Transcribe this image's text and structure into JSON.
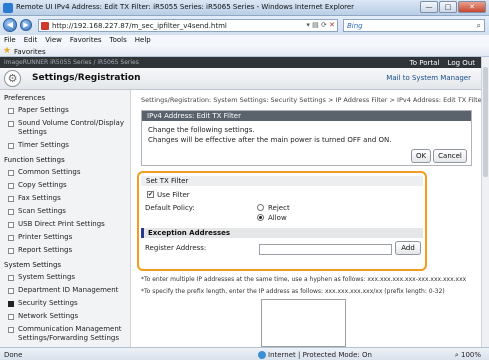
{
  "window": {
    "title": "Remote UI IPv4 Address: Edit TX Filter: iR5055 Series: iR5065 Series - Windows Internet Explorer",
    "min": "—",
    "max": "□",
    "close": "✕"
  },
  "browser": {
    "url": "http://192.168.227.87/m_sec_ipfilter_v4send.html",
    "search_placeholder": "Bing",
    "menu": [
      "File",
      "Edit",
      "View",
      "Favorites",
      "Tools",
      "Help"
    ],
    "favorites_label": "Favorites"
  },
  "device_bar": {
    "device_name": "imageRUNNER  iR5055 Series / iR5065 Series",
    "to_portal": "To Portal",
    "log_out": "Log Out"
  },
  "header": {
    "title": "Settings/Registration",
    "mail": "Mail to System Manager"
  },
  "sidebar": {
    "preferences": "Preferences",
    "pref_items": [
      "Paper Settings",
      "Sound Volume Control/Display Settings",
      "Timer Settings"
    ],
    "function_settings": "Function Settings",
    "func_items": [
      "Common Settings",
      "Copy Settings",
      "Fax Settings",
      "Scan Settings",
      "USB Direct Print Settings",
      "Printer Settings",
      "Report Settings"
    ],
    "system_settings": "System Settings",
    "sys_items": [
      "System Settings",
      "Department ID Management",
      "Security Settings",
      "Network Settings",
      "Communication Management Settings/Forwarding Settings"
    ]
  },
  "main": {
    "breadcrumb": "Settings/Registration: System Settings: Security Settings > IP Address Filter > IPv4 Address: Edit TX Filter",
    "panel_title": "IPv4 Address: Edit TX Filter",
    "panel_line1": "Change the following settings.",
    "panel_line2": "Changes will be effective after the main power is turned OFF and ON.",
    "ok": "OK",
    "cancel": "Cancel",
    "set_tx_filter": "Set TX Filter",
    "use_filter": "Use Filter",
    "use_filter_checked": true,
    "default_policy": "Default Policy:",
    "reject": "Reject",
    "allow": "Allow",
    "selected_policy": "Allow",
    "exception_addresses": "Exception Addresses",
    "register_address": "Register Address:",
    "register_value": "",
    "add": "Add",
    "note1": "*To enter multiple IP addresses at the same time, use a hyphen as follows: xxx.xxx.xxx.xxx-xxx.xxx.xxx.xxx",
    "note2": "*To specify the prefix length, enter the IP address as follows: xxx.xxx.xxx.xxx/xx (prefix length: 0-32)"
  },
  "status": {
    "done": "Done",
    "zone": "Internet | Protected Mode: On",
    "zoom": "100%"
  },
  "colors": {
    "highlight_border": "#f39c1f",
    "device_bar": "#2f3439",
    "panel_header": "#5a636c"
  }
}
